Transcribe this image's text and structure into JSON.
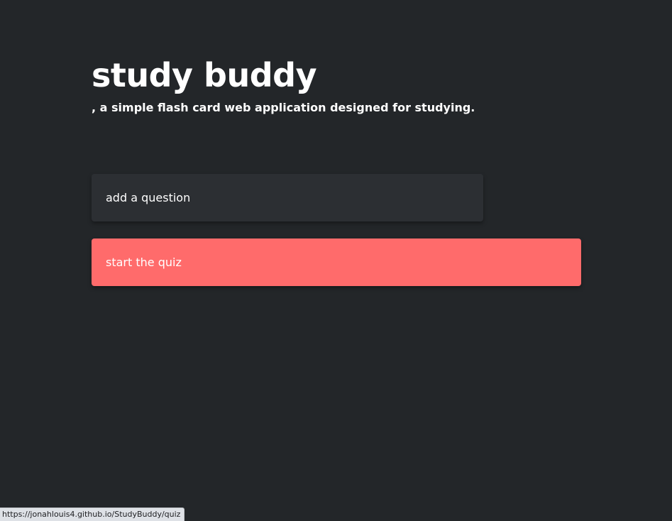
{
  "header": {
    "title": "study buddy",
    "subtitle": ", a simple flash card web application designed for studying."
  },
  "actions": {
    "add_question_label": "add a question",
    "start_quiz_label": "start the quiz"
  },
  "status_bar": {
    "url": "https://jonahlouis4.github.io/StudyBuddy/quiz"
  },
  "colors": {
    "background": "#232629",
    "add_button": "#2c2f33",
    "start_button": "#ff6b6b",
    "text": "#ffffff"
  }
}
